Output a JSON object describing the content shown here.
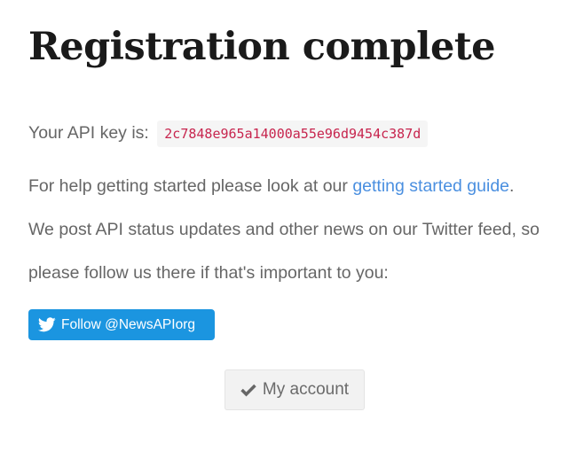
{
  "heading": "Registration complete",
  "api_key": {
    "label": "Your API key is:",
    "value": "2c7848e965a14000a55e96d9454c387d"
  },
  "help": {
    "prefix": "For help getting started please look at our ",
    "link_text": "getting started guide",
    "suffix": "."
  },
  "news": {
    "line1": "We post API status updates and other news on our Twitter feed, so",
    "line2": "please follow us there if that's important to you:"
  },
  "twitter_button": {
    "label": "Follow @NewsAPIorg",
    "icon": "twitter-bird-icon",
    "color": "#1b95e0"
  },
  "account_button": {
    "label": "My account",
    "icon": "check-icon"
  },
  "colors": {
    "link": "#4a8fe0",
    "code_text": "#c7254e",
    "code_bg": "#f5f5f5"
  }
}
